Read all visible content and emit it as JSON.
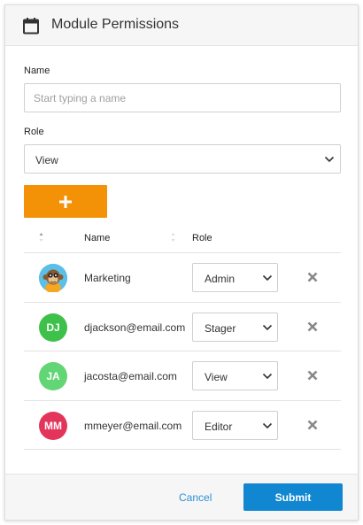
{
  "header": {
    "title": "Module Permissions",
    "icon": "calendar-icon"
  },
  "form": {
    "name_label": "Name",
    "name_placeholder": "Start typing a name",
    "role_label": "Role",
    "role_value": "View",
    "add_icon": "plus-icon"
  },
  "table": {
    "col_name": "Name",
    "col_role": "Role",
    "rows": [
      {
        "name": "Marketing",
        "role": "Admin",
        "avatar_type": "image",
        "avatar_initials": ""
      },
      {
        "name": "djackson@email.com",
        "role": "Stager",
        "avatar_type": "initials",
        "avatar_initials": "DJ",
        "avatar_color": "#3ec14a"
      },
      {
        "name": "jacosta@email.com",
        "role": "View",
        "avatar_type": "initials",
        "avatar_initials": "JA",
        "avatar_color": "#62d574"
      },
      {
        "name": "mmeyer@email.com",
        "role": "Editor",
        "avatar_type": "initials",
        "avatar_initials": "MM",
        "avatar_color": "#e3355b"
      }
    ]
  },
  "footer": {
    "cancel_label": "Cancel",
    "submit_label": "Submit"
  },
  "colors": {
    "accent_orange": "#f39206",
    "primary_blue": "#1187d1",
    "link_blue": "#2f8fd6"
  }
}
